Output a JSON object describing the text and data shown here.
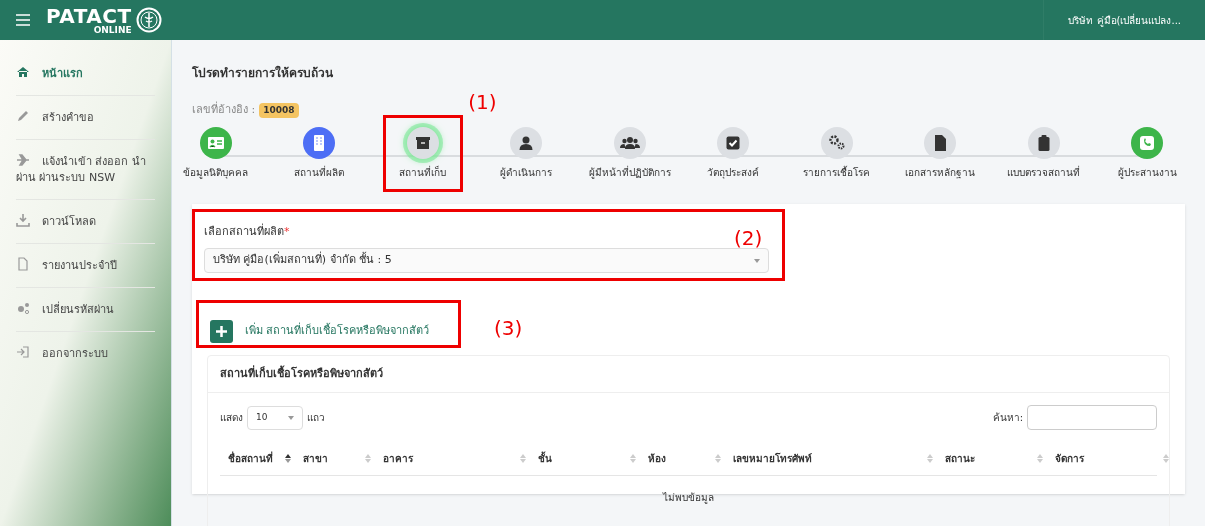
{
  "header": {
    "logo_title": "PATACT",
    "logo_subtitle": "ONLINE",
    "user": "บริษัท คู่มือ(เปลี่ยนแปลง..."
  },
  "sidebar": {
    "items": [
      {
        "label": "หน้าแรก",
        "kind": "home",
        "selected": true
      },
      {
        "label": "สร้างคำขอ",
        "kind": "pencil",
        "selected": false
      },
      {
        "label": "แจ้งนำเข้า ส่งออก นำผ่าน ผ่านระบบ NSW",
        "kind": "plane",
        "selected": false
      },
      {
        "label": "ดาวน์โหลด",
        "kind": "download",
        "selected": false
      },
      {
        "label": "รายงานประจำปี",
        "kind": "file",
        "selected": false
      },
      {
        "label": "เปลี่ยนรหัสผ่าน",
        "kind": "gears",
        "selected": false
      },
      {
        "label": "ออกจากระบบ",
        "kind": "logout",
        "selected": false
      }
    ]
  },
  "page": {
    "title": "โปรดทำรายการให้ครบถ้วน",
    "reference_label": "เลขที่อ้างอิง :",
    "reference_number": "10008"
  },
  "steps": [
    {
      "label": "ข้อมูลนิติบุคคล",
      "kind": "id-card",
      "color": "#3db54a",
      "selected": false
    },
    {
      "label": "สถานที่ผลิต",
      "kind": "building",
      "color": "#4d6ef5",
      "selected": false
    },
    {
      "label": "สถานที่เก็บ",
      "kind": "archive",
      "color": "#dcdfe3",
      "selected": true
    },
    {
      "label": "ผู้ดำเนินการ",
      "kind": "user",
      "color": "#dcdfe3",
      "selected": false
    },
    {
      "label": "ผู้มีหน้าที่ปฏิบัติการ",
      "kind": "users",
      "color": "#dcdfe3",
      "selected": false
    },
    {
      "label": "วัตถุประสงค์",
      "kind": "check",
      "color": "#dcdfe3",
      "selected": false
    },
    {
      "label": "รายการเชื้อโรค",
      "kind": "cogs",
      "color": "#dcdfe3",
      "selected": false
    },
    {
      "label": "เอกสารหลักฐาน",
      "kind": "document",
      "color": "#dcdfe3",
      "selected": false
    },
    {
      "label": "แบบตรวจสถานที่",
      "kind": "clipboard",
      "color": "#dcdfe3",
      "selected": false
    },
    {
      "label": "ผู้ประสานงาน",
      "kind": "phone",
      "color": "#3db54a",
      "selected": false
    }
  ],
  "form": {
    "select_label": "เลือกสถานที่ผลิต",
    "required_mark": "*",
    "select_value": "บริษัท คู่มือ(เพิ่มสถานที่) จำกัด ชั้น : 5",
    "add_button": "เพิ่ม สถานที่เก็บเชื้อโรคหรือพิษจากสัตว์"
  },
  "table": {
    "title": "สถานที่เก็บเชื้อโรคหรือพิษจากสัตว์",
    "length_label": "แสดง",
    "length_value": "10",
    "length_suffix": "แถว",
    "search_label": "ค้นหา:",
    "columns": [
      {
        "label": "ชื่อสถานที่",
        "sorted": true
      },
      {
        "label": "สาขา",
        "sorted": false
      },
      {
        "label": "อาคาร",
        "sorted": false
      },
      {
        "label": "ชั้น",
        "sorted": false
      },
      {
        "label": "ห้อง",
        "sorted": false
      },
      {
        "label": "เลขหมายโทรศัพท์",
        "sorted": false
      },
      {
        "label": "สถานะ",
        "sorted": false
      },
      {
        "label": "จัดการ",
        "sorted": false
      }
    ],
    "empty_message": "ไม่พบข้อมูล"
  },
  "annotations": [
    {
      "label": "(1)"
    },
    {
      "label": "(2)"
    },
    {
      "label": "(3)"
    }
  ]
}
